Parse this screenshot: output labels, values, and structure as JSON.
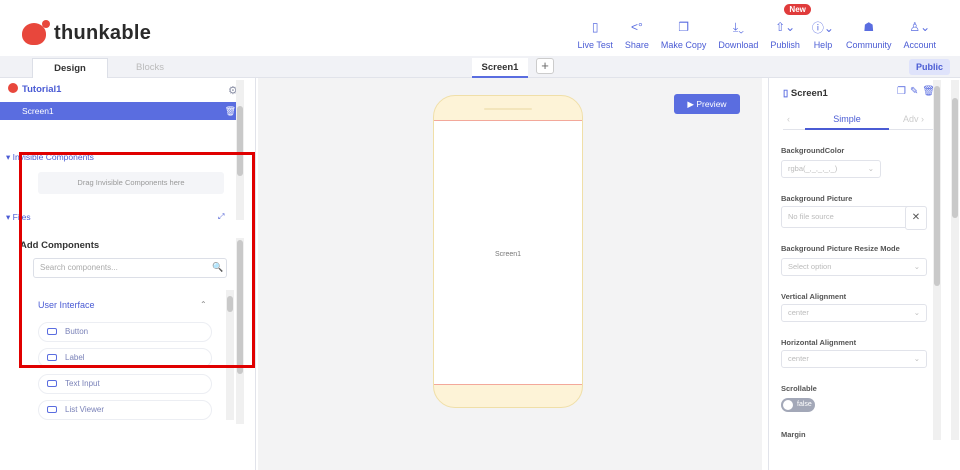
{
  "app": {
    "brand": "thunkable"
  },
  "nav": [
    {
      "label": "Live Test",
      "icon": "phone-icon"
    },
    {
      "label": "Share",
      "icon": "share-icon"
    },
    {
      "label": "Make Copy",
      "icon": "copy-icon"
    },
    {
      "label": "Download",
      "icon": "download-icon"
    },
    {
      "label": "Publish",
      "icon": "publish-icon",
      "badge": "New"
    },
    {
      "label": "Help",
      "icon": "help-icon"
    },
    {
      "label": "Community",
      "icon": "community-icon"
    },
    {
      "label": "Account",
      "icon": "account-icon"
    }
  ],
  "tabs": {
    "design": "Design",
    "blocks": "Blocks",
    "screen": "Screen1",
    "plus": "+",
    "public": "Public"
  },
  "left": {
    "project": "Tutorial1",
    "screen_item": "Screen1",
    "invisible_title": "Invisible Components",
    "invisible_drop": "Drag Invisible Components here",
    "files_title": "Files",
    "add_title": "Add Components",
    "search_placeholder": "Search components...",
    "ui_title": "User Interface",
    "components": [
      "Button",
      "Label",
      "Text Input",
      "List Viewer"
    ]
  },
  "canvas": {
    "preview": "Preview",
    "phone_label": "Screen1"
  },
  "right": {
    "title": "Screen1",
    "tab_simple": "Simple",
    "tab_adv": "Adv",
    "bg_color_label": "BackgroundColor",
    "bg_color_value": "rgba(_,_,_,_,_)",
    "bg_picture_label": "Background Picture",
    "bg_picture_value": "No file source",
    "resize_label": "Background Picture Resize Mode",
    "resize_value": "Select option",
    "valign_label": "Vertical Alignment",
    "valign_value": "center",
    "halign_label": "Horizontal Alignment",
    "halign_value": "center",
    "scrollable_label": "Scrollable",
    "scrollable_value": "false",
    "margin_label": "Margin"
  },
  "colors": {
    "accent": "#5a6de0",
    "highlight": "#e00000",
    "phone": "#fdf3d7"
  }
}
